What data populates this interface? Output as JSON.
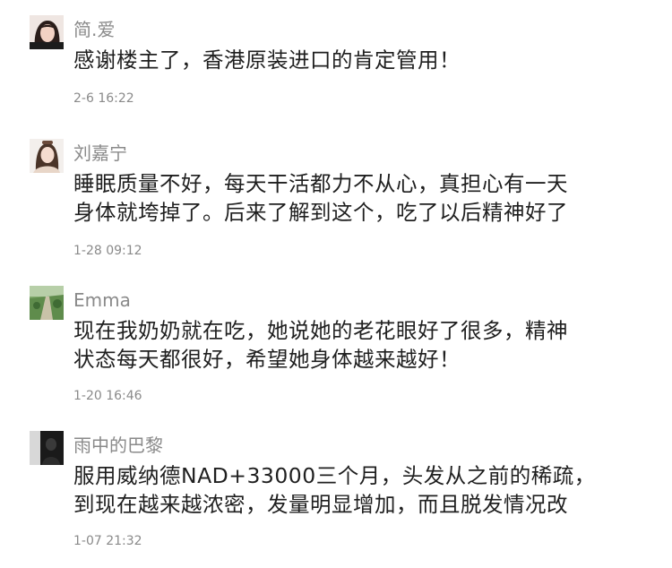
{
  "comments": [
    {
      "username": "简.爱",
      "lines": [
        "感谢楼主了，香港原装进口的肯定管用！"
      ],
      "time": "2-6  16:22",
      "avatar_icon": "avatar-girl-dark-hair"
    },
    {
      "username": "刘嘉宁",
      "lines": [
        "睡眠质量不好，每天干活都力不从心，真担心有一天",
        "身体就垮掉了。后来了解到这个，吃了以后精神好了"
      ],
      "time": "1-28  09:12",
      "avatar_icon": "avatar-woman-light"
    },
    {
      "username": "Emma",
      "lines": [
        "现在我奶奶就在吃，她说她的老花眼好了很多，精神",
        "状态每天都很好，希望她身体越来越好！"
      ],
      "time": "1-20  16:46",
      "avatar_icon": "avatar-green-landscape"
    },
    {
      "username": "雨中的巴黎",
      "lines": [
        "服用威纳德NAD+33000三个月，头发从之前的稀疏，",
        "到现在越来越浓密，发量明显增加，而且脱发情况改"
      ],
      "time": "1-07  21:32",
      "avatar_icon": "avatar-dark-portrait"
    }
  ]
}
